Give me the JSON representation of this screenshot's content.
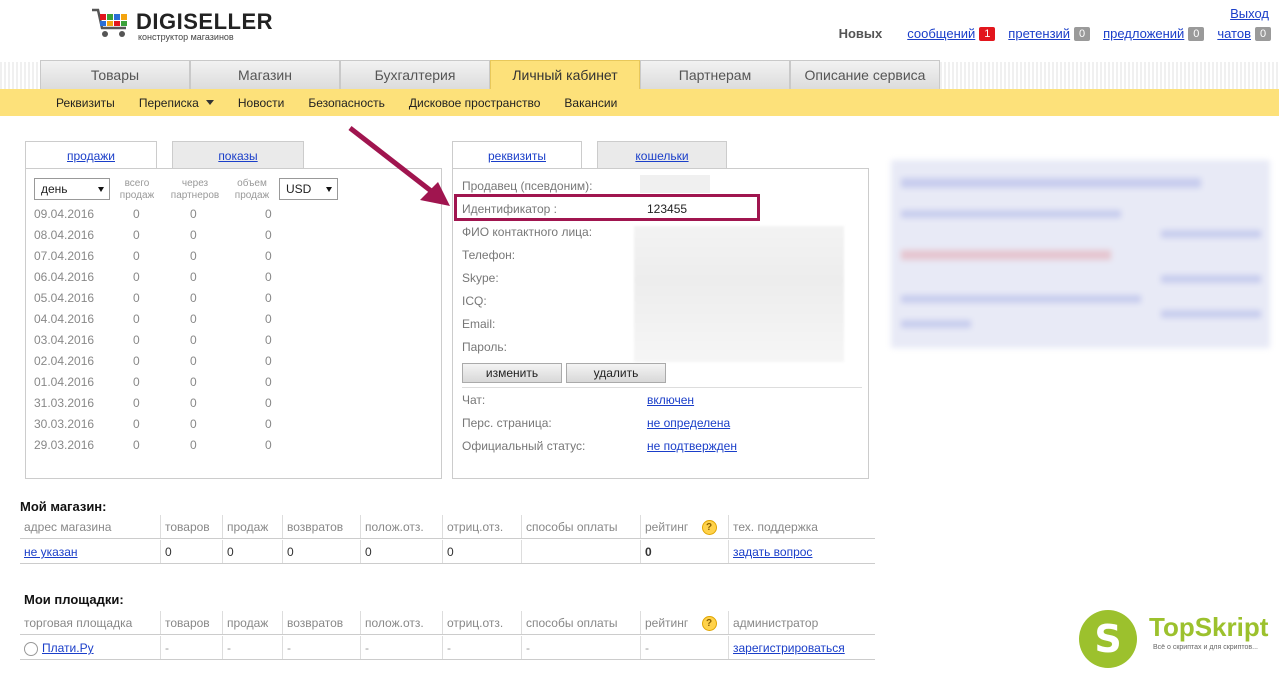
{
  "header": {
    "brand": "DIGISELLER",
    "tagline": "конструктор магазинов",
    "exit_label": "Выход",
    "notif_label": "Новых",
    "notifications": [
      {
        "label": "сообщений",
        "count": "1",
        "color": "#e2161d"
      },
      {
        "label": "претензий",
        "count": "0",
        "color": "#9a9a9a"
      },
      {
        "label": "предложений",
        "count": "0",
        "color": "#9a9a9a"
      },
      {
        "label": "чатов",
        "count": "0",
        "color": "#9a9a9a"
      }
    ]
  },
  "tabs": [
    "Товары",
    "Магазин",
    "Бухгалтерия",
    "Личный кабинет",
    "Партнерам",
    "Описание сервиса"
  ],
  "active_tab": "Личный кабинет",
  "subnav": [
    "Реквизиты",
    "Переписка",
    "Новости",
    "Безопасность",
    "Дисковое пространство",
    "Вакансии"
  ],
  "sales": {
    "tabs": [
      "продажи",
      "показы"
    ],
    "period": "день",
    "currency": "USD",
    "col1": "всего продаж",
    "col2": "через партнеров",
    "col3": "объем продаж",
    "rows": [
      {
        "date": "09.04.2016",
        "a": "0",
        "b": "0",
        "c": "0"
      },
      {
        "date": "08.04.2016",
        "a": "0",
        "b": "0",
        "c": "0"
      },
      {
        "date": "07.04.2016",
        "a": "0",
        "b": "0",
        "c": "0"
      },
      {
        "date": "06.04.2016",
        "a": "0",
        "b": "0",
        "c": "0"
      },
      {
        "date": "05.04.2016",
        "a": "0",
        "b": "0",
        "c": "0"
      },
      {
        "date": "04.04.2016",
        "a": "0",
        "b": "0",
        "c": "0"
      },
      {
        "date": "03.04.2016",
        "a": "0",
        "b": "0",
        "c": "0"
      },
      {
        "date": "02.04.2016",
        "a": "0",
        "b": "0",
        "c": "0"
      },
      {
        "date": "01.04.2016",
        "a": "0",
        "b": "0",
        "c": "0"
      },
      {
        "date": "31.03.2016",
        "a": "0",
        "b": "0",
        "c": "0"
      },
      {
        "date": "30.03.2016",
        "a": "0",
        "b": "0",
        "c": "0"
      },
      {
        "date": "29.03.2016",
        "a": "0",
        "b": "0",
        "c": "0"
      }
    ]
  },
  "details": {
    "tabs": [
      "реквизиты",
      "кошельки"
    ],
    "seller_label": "Продавец (псевдоним):",
    "id_label": "Идентификатор :",
    "id_value": "123455",
    "fio_label": "ФИО контактного лица:",
    "phone_label": "Телефон:",
    "skype_label": "Skype:",
    "icq_label": "ICQ:",
    "email_label": "Email:",
    "password_label": "Пароль:",
    "edit_button": "изменить",
    "delete_button": "удалить",
    "chat_label": "Чат:",
    "chat_value": "включен",
    "page_label": "Перс. страница:",
    "page_value": "не определена",
    "status_label": "Официальный статус:",
    "status_value": "не подтвержден"
  },
  "my_shop": {
    "title": "Мой магазин:",
    "headers": [
      "адрес магазина",
      "товаров",
      "продаж",
      "возвратов",
      "полож.отз.",
      "отриц.отз.",
      "способы оплаты",
      "рейтинг",
      "?",
      "тех. поддержка"
    ],
    "row": [
      "не указан",
      "0",
      "0",
      "0",
      "0",
      "0",
      "",
      "0",
      "",
      "задать вопрос"
    ]
  },
  "my_sites": {
    "title": "Мои площадки:",
    "headers": [
      "торговая площадка",
      "товаров",
      "продаж",
      "возвратов",
      "полож.отз.",
      "отриц.отз.",
      "способы оплаты",
      "рейтинг",
      "?",
      "администратор"
    ],
    "row": [
      "Плати.Ру",
      "-",
      "-",
      "-",
      "-",
      "-",
      "-",
      "-",
      "",
      "зарегистрироваться"
    ]
  },
  "watermark": {
    "brand": "TopSkript",
    "tagline": "Всё о скриптах и для скриптов..."
  }
}
